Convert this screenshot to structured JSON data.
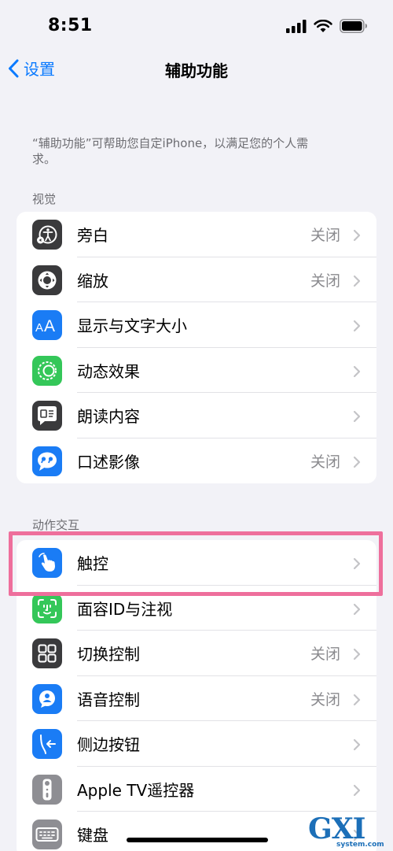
{
  "status_bar": {
    "time": "8:51"
  },
  "nav": {
    "back_label": "设置",
    "title": "辅助功能"
  },
  "description": "“辅助功能”可帮助您自定iPhone，以满足您的个人需求。",
  "sections": [
    {
      "header": "视觉",
      "items": [
        {
          "label": "旁白",
          "value": "关闭",
          "icon": "voiceover-icon",
          "color": "#3a3a3c"
        },
        {
          "label": "缩放",
          "value": "关闭",
          "icon": "zoom-icon",
          "color": "#3a3a3c"
        },
        {
          "label": "显示与文字大小",
          "value": "",
          "icon": "text-size-icon",
          "color": "#1a7cf5"
        },
        {
          "label": "动态效果",
          "value": "",
          "icon": "motion-icon",
          "color": "#34c759"
        },
        {
          "label": "朗读内容",
          "value": "",
          "icon": "spoken-content-icon",
          "color": "#3a3a3c"
        },
        {
          "label": "口述影像",
          "value": "关闭",
          "icon": "audio-description-icon",
          "color": "#1a7cf5"
        }
      ]
    },
    {
      "header": "动作交互",
      "items": [
        {
          "label": "触控",
          "value": "",
          "icon": "touch-icon",
          "color": "#1a7cf5"
        },
        {
          "label": "面容ID与注视",
          "value": "",
          "icon": "face-id-icon",
          "color": "#34c759"
        },
        {
          "label": "切换控制",
          "value": "关闭",
          "icon": "switch-control-icon",
          "color": "#3a3a3c"
        },
        {
          "label": "语音控制",
          "value": "关闭",
          "icon": "voice-control-icon",
          "color": "#1a7cf5"
        },
        {
          "label": "侧边按钮",
          "value": "",
          "icon": "side-button-icon",
          "color": "#1a7cf5"
        },
        {
          "label": "Apple TV遥控器",
          "value": "",
          "icon": "tv-remote-icon",
          "color": "#8e8e93"
        },
        {
          "label": "键盘",
          "value": "",
          "icon": "keyboard-icon",
          "color": "#8e8e93"
        }
      ]
    }
  ],
  "watermark": {
    "big": "GXI网",
    "small": "system.com"
  }
}
